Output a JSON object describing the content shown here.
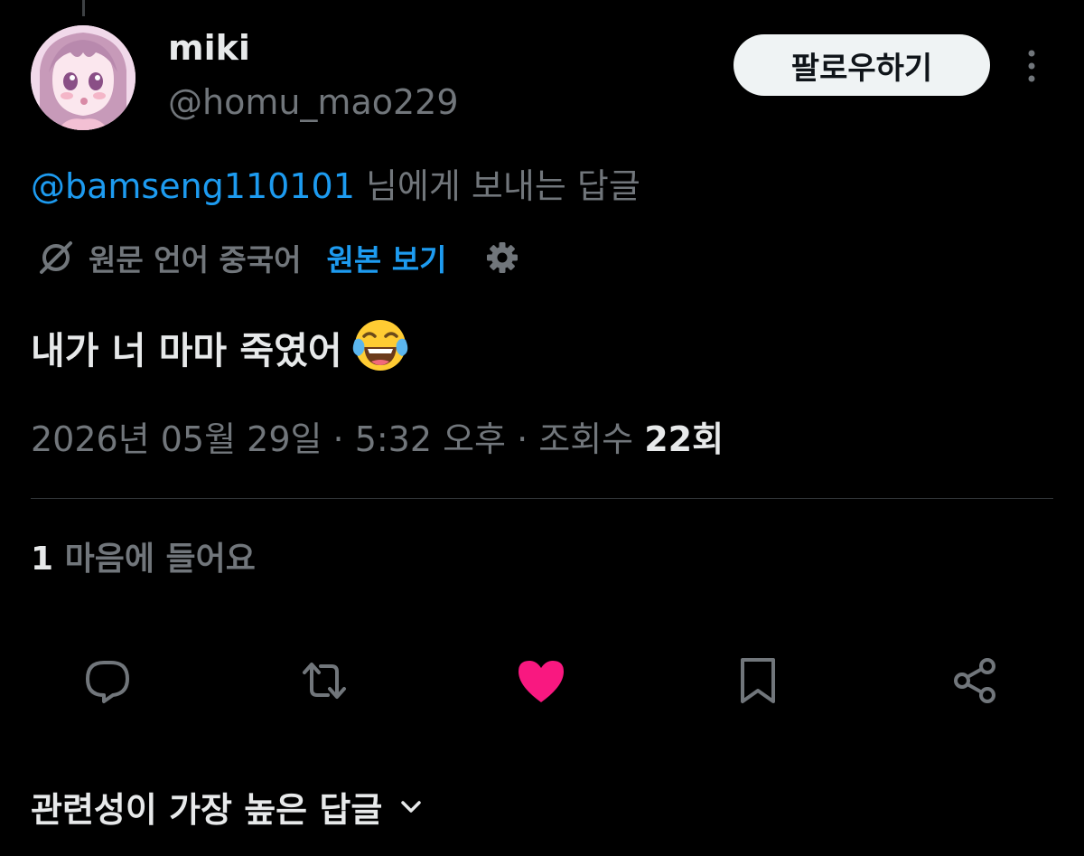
{
  "user": {
    "display_name": "miki",
    "handle": "@homu_mao229",
    "avatar_icon": "anime-girl-avatar"
  },
  "header": {
    "follow_label": "팔로우하기",
    "more_icon": "more-vertical-icon"
  },
  "reply_context": {
    "mention": "@bamseng110101",
    "suffix": " 님에게 보내는 답글"
  },
  "translation": {
    "label": "원문 언어 중국어",
    "view_original": "원본 보기",
    "icon": "translate-icon",
    "settings_icon": "gear-icon"
  },
  "tweet": {
    "text": "내가 너 마마 죽였어",
    "emoji": "face-with-tears-of-joy"
  },
  "meta": {
    "datetime": "2026년 05월 29일 · 5:32 오후 · ",
    "views_label": "조회수 ",
    "views_count": "22회"
  },
  "engagement": {
    "likes_count": "1",
    "likes_label": " 마음에 들어요"
  },
  "actions": [
    {
      "name": "reply",
      "icon": "reply-icon"
    },
    {
      "name": "retweet",
      "icon": "retweet-icon"
    },
    {
      "name": "like",
      "icon": "heart-icon",
      "active": true
    },
    {
      "name": "bookmark",
      "icon": "bookmark-icon"
    },
    {
      "name": "share",
      "icon": "share-icon"
    }
  ],
  "replies": {
    "sort_label": "관련성이 가장 높은 답글",
    "sort_icon": "chevron-down-icon"
  },
  "colors": {
    "background": "#000000",
    "text_primary": "#e7e9ea",
    "text_secondary": "#71767b",
    "accent_blue": "#1d9bf0",
    "like_pink": "#f91880",
    "divider": "#2f3336"
  }
}
